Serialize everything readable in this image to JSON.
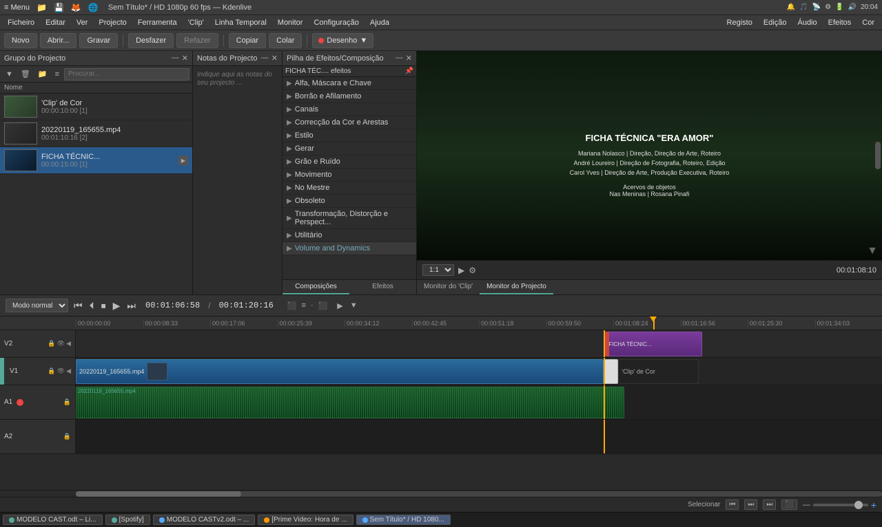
{
  "app": {
    "title": "Sem Título* / HD 1080p 60 fps — Kdenlive",
    "menu_btn": "≡ Menu"
  },
  "topbar": {
    "icons": [
      "🔔",
      "🎵",
      "⚙",
      "🔧",
      "📡",
      "🔋",
      "📶",
      "time"
    ],
    "time": "20:04"
  },
  "menubar": {
    "items": [
      "Ficheiro",
      "Editar",
      "Ver",
      "Projecto",
      "Ferramenta",
      "'Clip'",
      "Linha Temporal",
      "Monitor",
      "Configuração",
      "Ajuda"
    ],
    "right_items": [
      "Registo",
      "Edição",
      "Áudio",
      "Efeitos",
      "Cor"
    ]
  },
  "toolbar": {
    "novo": "Novo",
    "abrir": "Abrir...",
    "gravar": "Gravar",
    "desfazer": "Desfazer",
    "refazer": "Refazer",
    "copiar": "Copiar",
    "colar": "Colar",
    "desenho": "Desenho"
  },
  "project_panel": {
    "title": "Grupo do Projecto",
    "search_placeholder": "Procurar...",
    "col_name": "Nome",
    "clips": [
      {
        "name": "'Clip' de Cor",
        "duration": "00:00:10:00 [1]",
        "type": "color"
      },
      {
        "name": "20220119_165655.mp4",
        "duration": "00:01:10:16 [2]",
        "type": "video"
      },
      {
        "name": "FICHA TÉCNIC...",
        "duration": "00:00:15:00 [1]",
        "type": "title",
        "selected": true
      }
    ]
  },
  "notes_panel": {
    "title": "Notas do Projecto",
    "placeholder": "Indique aqui as notas do seu projecto ..."
  },
  "effects_panel": {
    "title": "Pilha de Efeitos/Composição",
    "search_placeholder": "FICHA TÉC.... efeitos",
    "categories": [
      "Alfa, Máscara e Chave",
      "Borrão e Afilamento",
      "Canais",
      "Correcção da Cor e Arestas",
      "Estilo",
      "Gerar",
      "Grão e Ruído",
      "Movimento",
      "No Mestre",
      "Obsoleto",
      "Transformação, Distorção e Perspect...",
      "Utilitário",
      "Volume and Dynamics"
    ],
    "tabs": [
      "Composições",
      "Efeitos"
    ],
    "active_tab": "Composições"
  },
  "preview_panel": {
    "zoom": "1:1",
    "timecode": "00:01:08:10",
    "video_title": "FICHA TÉCNICA \"ERA AMOR\"",
    "credits": [
      "Mariana Nolasco | Direção, Direção de Arte, Roteiro",
      "André Loureiro | Direção de Fotografia, Roteiro, Edição",
      "Carol Yves | Direção de Arte, Produção Executiva, Roteiro"
    ],
    "acervos_title": "Acervos de objetos",
    "acervos_names": "Nas Meninas | Rosana Pinafi",
    "tabs": [
      "Monitor do 'Clip'",
      "Monitor do Projecto"
    ],
    "active_tab": "Monitor do Projecto"
  },
  "transport": {
    "mode": "Modo normal",
    "current_time": "00:01:06:58",
    "total_time": "00:01:20:16"
  },
  "timeline": {
    "ruler_marks": [
      "00:00:00:00",
      "00:00:08:33",
      "00:00:17:06",
      "00:00:25:39",
      "00:00:34:12",
      "00:00:42:45",
      "00:00:51:18",
      "00:00:59:50",
      "00:01:08:24",
      "00:01:16:56",
      "00:01:25:30",
      "00:01:34:03"
    ],
    "tracks": [
      {
        "name": "V2",
        "type": "video"
      },
      {
        "name": "V1",
        "type": "video"
      },
      {
        "name": "A1",
        "type": "audio"
      },
      {
        "name": "A2",
        "type": "audio"
      }
    ],
    "clips": {
      "v2": [
        {
          "label": "FICHA TÉCNIC...",
          "start_pct": 65.5,
          "width_pct": 12,
          "type": "purple"
        }
      ],
      "v1": [
        {
          "label": "20220119_165655.mp4",
          "start_pct": 0,
          "width_pct": 65.5,
          "type": "video"
        },
        {
          "label": "'Clip' de Cor",
          "start_pct": 65.5,
          "width_pct": 1.5,
          "type": "white-block"
        },
        {
          "label": "dark",
          "start_pct": 67,
          "width_pct": 10.5,
          "type": "dark-block"
        }
      ]
    }
  },
  "statusbar": {
    "selecionar": "Selecionar"
  },
  "taskbar": {
    "items": [
      {
        "label": "MODELO CAST.odt – Li...",
        "dot": "green"
      },
      {
        "label": "[Spotify]",
        "dot": "green"
      },
      {
        "label": "MODELO CASTv2.odt – ...",
        "dot": "blue"
      },
      {
        "label": "[Prime Video: Hora de ...",
        "dot": "orange"
      },
      {
        "label": "Sem Título* / HD 1080...",
        "dot": "blue"
      }
    ]
  }
}
